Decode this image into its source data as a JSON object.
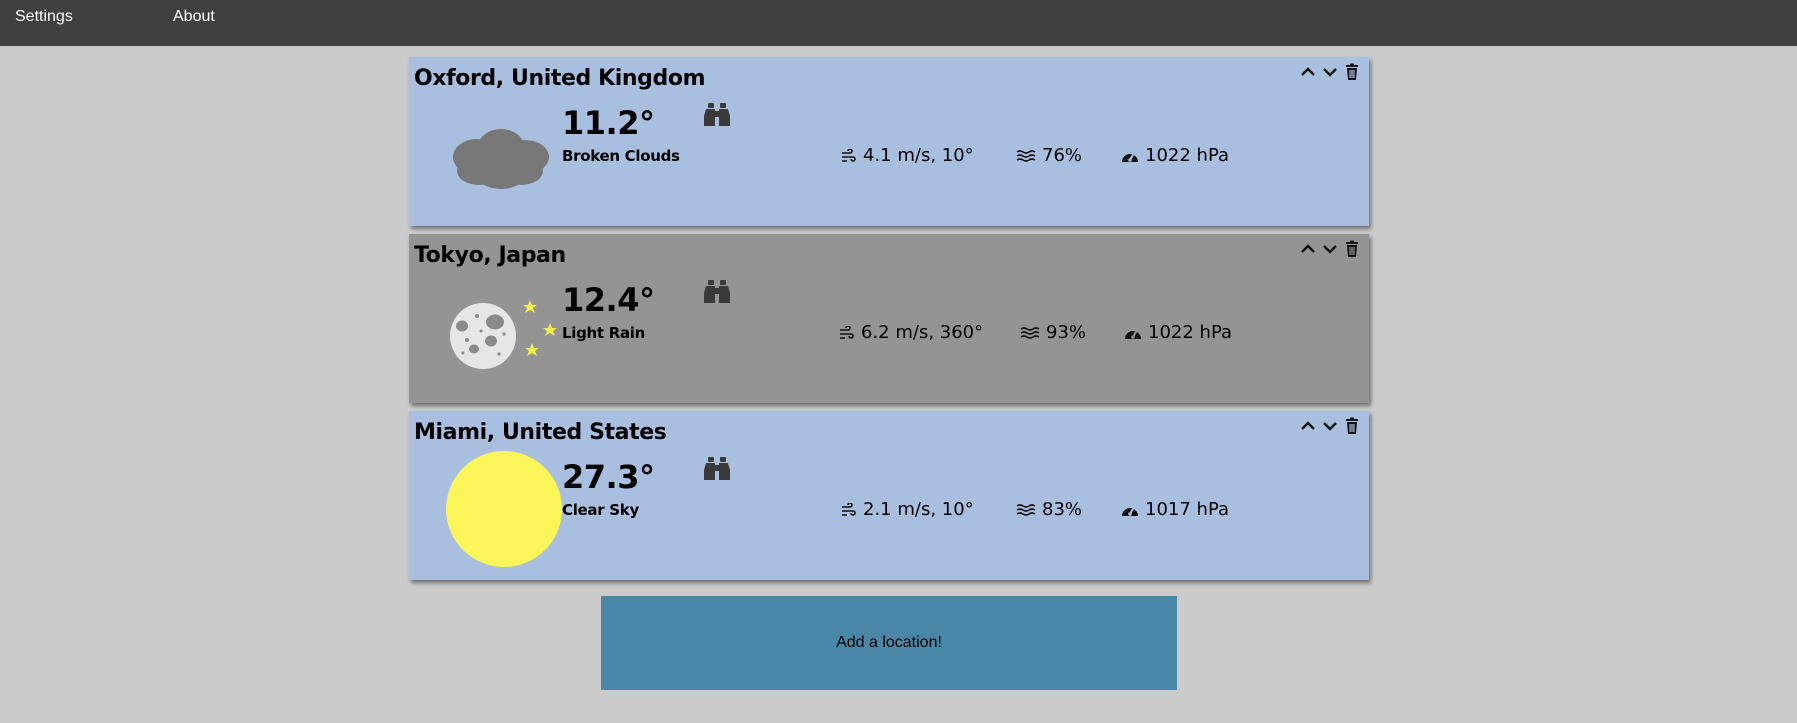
{
  "nav": {
    "settings_label": "Settings",
    "about_label": "About"
  },
  "locations": [
    {
      "city": "Oxford, United Kingdom",
      "temperature": "11.2°",
      "description": "Broken Clouds",
      "wind": "4.1 m/s, 10°",
      "humidity": "76%",
      "pressure": "1022 hPa",
      "condition_icon": "cloud-icon",
      "theme": "day"
    },
    {
      "city": "Tokyo, Japan",
      "temperature": "12.4°",
      "description": "Light Rain",
      "wind": "6.2 m/s, 360°",
      "humidity": "93%",
      "pressure": "1022 hPa",
      "condition_icon": "moon-icon",
      "theme": "night"
    },
    {
      "city": "Miami, United States",
      "temperature": "27.3°",
      "description": "Clear Sky",
      "wind": "2.1 m/s, 10°",
      "humidity": "83%",
      "pressure": "1017 hPa",
      "condition_icon": "sun-icon",
      "theme": "day"
    }
  ],
  "add_location_label": "Add a location!",
  "colors": {
    "topbar": "#404040",
    "background": "#cbcbcb",
    "day_card": "#a9bfdf",
    "night_card": "#949494",
    "add_button": "#4a86a6",
    "sun": "#fbf55a",
    "cloud": "#777777",
    "moon": "#e6e6e6",
    "star": "#f5ef4e"
  }
}
